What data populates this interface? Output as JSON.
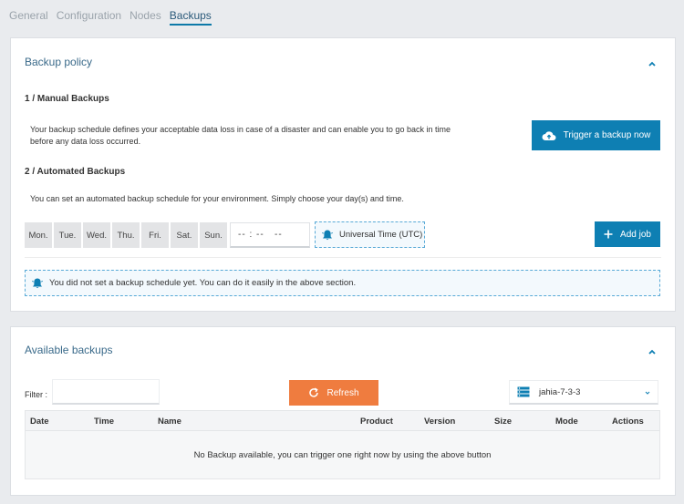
{
  "tabs": [
    {
      "label": "General",
      "active": false
    },
    {
      "label": "Configuration",
      "active": false
    },
    {
      "label": "Nodes",
      "active": false
    },
    {
      "label": "Backups",
      "active": true
    }
  ],
  "backup_policy": {
    "title": "Backup policy",
    "manual": {
      "label": "1 / Manual Backups",
      "description_line1": "Your backup schedule defines your acceptable data loss in case of a disaster and can enable you to go back in time",
      "description_line2": "before any data loss occurred.",
      "trigger_button": "Trigger a backup now"
    },
    "automated": {
      "label": "2 / Automated Backups",
      "description": "You can set an automated backup schedule for your environment. Simply choose your day(s) and time.",
      "days": [
        "Mon.",
        "Tue.",
        "Wed.",
        "Thu.",
        "Fri.",
        "Sat.",
        "Sun."
      ],
      "time_placeholder": "-- : --   --",
      "timezone": "Universal Time (UTC)",
      "add_job_button": "Add job"
    },
    "notice": "You did not set a backup schedule yet. You can do it easily in the above section."
  },
  "available_backups": {
    "title": "Available backups",
    "filter_label": "Filter :",
    "filter_value": "",
    "refresh_button": "Refresh",
    "environment_select": "jahia-7-3-3",
    "columns": [
      "Date",
      "Time",
      "Name",
      "Product",
      "Version",
      "Size",
      "Mode",
      "Actions"
    ],
    "empty_message": "No Backup available, you can trigger one right now by using the above button"
  },
  "colors": {
    "primary": "#0e7fb3",
    "accent": "#ef7c3f",
    "notice_border": "#57a9d6"
  }
}
